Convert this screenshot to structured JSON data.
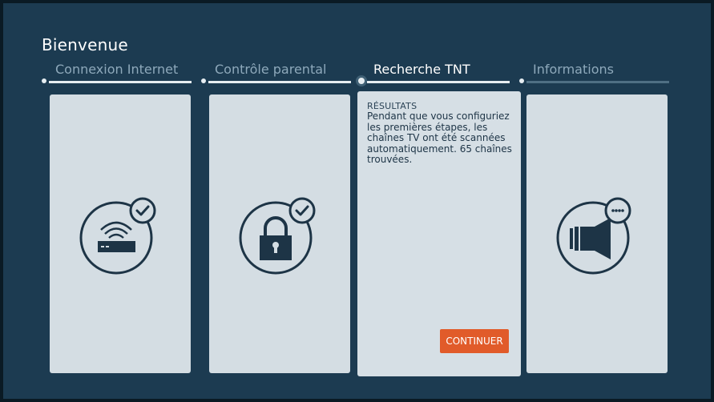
{
  "page": {
    "title": "Bienvenue"
  },
  "steps": [
    {
      "label": "Connexion Internet",
      "state": "done"
    },
    {
      "label": "Contrôle parental",
      "state": "done"
    },
    {
      "label": "Recherche TNT",
      "state": "active"
    },
    {
      "label": "Informations",
      "state": "pending"
    }
  ],
  "cards": {
    "internet": {
      "icon": "router-wifi-icon",
      "badge": "check-icon"
    },
    "parental": {
      "icon": "padlock-icon",
      "badge": "check-icon"
    },
    "tnt": {
      "results_label": "RÉSULTATS",
      "results_text": "Pendant que vous configuriez les premières étapes, les chaînes TV ont été scannées automatiquement. 65 chaînes trouvées.",
      "button_label": "CONTINUER"
    },
    "info": {
      "icon": "speaker-info-icon",
      "badge": "ellipsis-icon"
    }
  },
  "colors": {
    "background": "#1c3b51",
    "card": "#d4dde3",
    "accent": "#e15b2a",
    "icon_stroke": "#1d3446"
  }
}
